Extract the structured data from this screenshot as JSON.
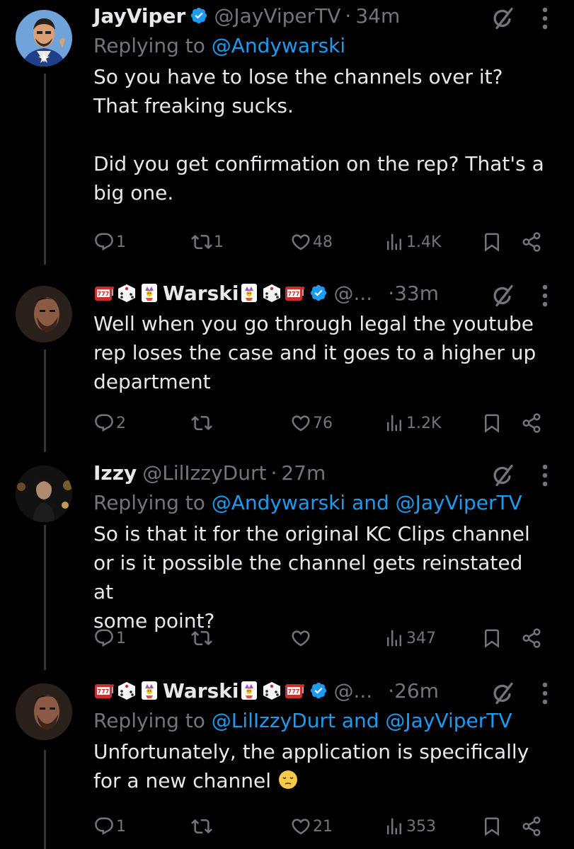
{
  "tweets": [
    {
      "name": "JayViper",
      "name_prefix_emojis": [],
      "name_suffix_emojis": [],
      "handle": "@JayViperTV",
      "time": "34m",
      "reply_prefix": "Replying to",
      "reply_targets": "@Andywarski",
      "body": "So you have to lose the channels over it?\nThat freaking sucks.\n\nDid you get confirmation on the rep? That's a\nbig one.",
      "stats": {
        "replies": "1",
        "retweets": "1",
        "likes": "48",
        "views": "1.4K"
      }
    },
    {
      "name": "Warski",
      "name_prefix_emojis": [
        "slot-machine",
        "game-die",
        "joker-card"
      ],
      "name_suffix_emojis": [
        "joker-card",
        "game-die",
        "slot-machine"
      ],
      "handle": "@...",
      "time": "33m",
      "reply_prefix": "",
      "reply_targets": "",
      "body": "Well when you go through legal the youtube\nrep loses the case and it goes to a higher up\ndepartment",
      "stats": {
        "replies": "2",
        "retweets": "",
        "likes": "76",
        "views": "1.2K"
      }
    },
    {
      "name": "Izzy",
      "name_prefix_emojis": [],
      "name_suffix_emojis": [],
      "handle": "@LilIzzyDurt",
      "time": "27m",
      "reply_prefix": "Replying to",
      "reply_targets": "@Andywarski and @JayViperTV",
      "body": "So is that it for the original KC Clips channel\nor is it possible the channel gets reinstated at\nsome point?",
      "stats": {
        "replies": "1",
        "retweets": "",
        "likes": "",
        "views": "347"
      }
    },
    {
      "name": "Warski",
      "name_prefix_emojis": [
        "slot-machine",
        "game-die",
        "joker-card"
      ],
      "name_suffix_emojis": [
        "joker-card",
        "game-die",
        "slot-machine"
      ],
      "handle": "@...",
      "time": "26m",
      "reply_prefix": "Replying to",
      "reply_targets": "@LilIzzyDurt and @JayViperTV",
      "body": "Unfortunately, the application is specifically\nfor a new channel",
      "body_trailing_emoji": "pensive-face-emoji",
      "stats": {
        "replies": "1",
        "retweets": "",
        "likes": "21",
        "views": "353"
      }
    }
  ],
  "icons": {
    "reply": "reply-icon",
    "retweet": "retweet-icon",
    "like": "heart-icon",
    "views": "views-chart-icon",
    "bookmark": "bookmark-icon",
    "share": "share-icon",
    "grok": "grok-icon",
    "more": "more-dots-icon",
    "verified": "verified-badge-icon"
  },
  "colors": {
    "background": "#000000",
    "text": "#e7e9ea",
    "muted": "#71767b",
    "link": "#1d9bf0",
    "verified": "#1d9bf0",
    "thread_line": "#333639"
  }
}
